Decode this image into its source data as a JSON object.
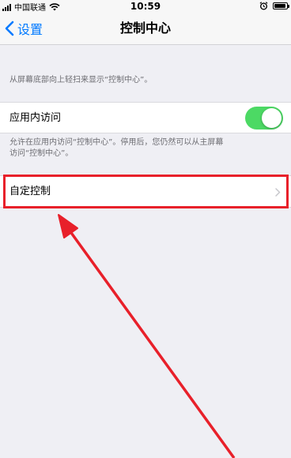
{
  "status_bar": {
    "carrier": "中国联通",
    "time": "10:59",
    "battery_level": 0.95
  },
  "nav": {
    "back_label": "设置",
    "title": "控制中心"
  },
  "intro_footnote": "从屏幕底部向上轻扫来显示“控制中心”。",
  "access_within_apps": {
    "label": "应用内访问",
    "enabled": true,
    "footnote_line1": "允许在应用内访问“控制中心”。停用后，您仍然可以从主屏幕",
    "footnote_line2": "访问“控制中心”。"
  },
  "customize": {
    "label": "自定控制"
  },
  "colors": {
    "accent": "#007aff",
    "toggle_on": "#4cd964",
    "annotation": "#e8202a",
    "background": "#efeff4"
  },
  "icons": [
    "signal-icon",
    "wifi-icon",
    "alarm-icon",
    "battery-icon",
    "chevron-left-icon",
    "chevron-right-icon"
  ]
}
